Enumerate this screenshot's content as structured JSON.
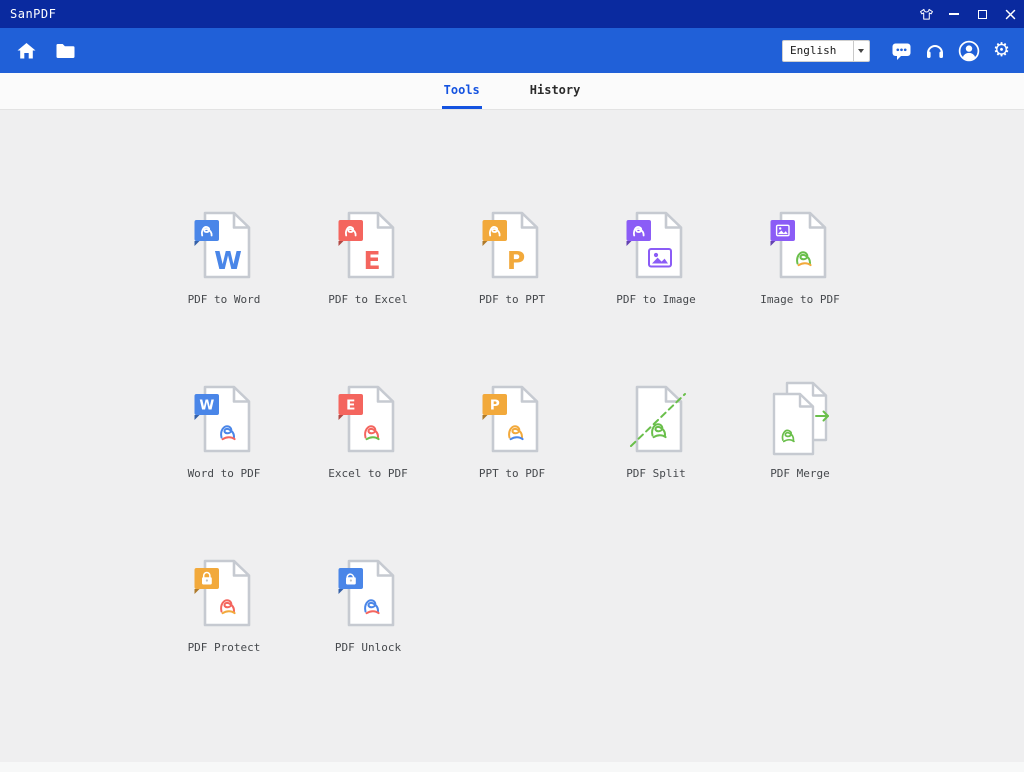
{
  "titlebar": {
    "title": "SanPDF",
    "icons": [
      "theme-icon",
      "minimize-button",
      "maximize-button",
      "close-button"
    ]
  },
  "toolbar": {
    "left_icons": [
      "home-icon",
      "folder-icon"
    ],
    "language": {
      "value": "English"
    },
    "right_icons": [
      "chat-icon",
      "headphones-icon",
      "user-icon",
      "settings-icon"
    ]
  },
  "tabs": [
    {
      "label": "Tools",
      "active": true
    },
    {
      "label": "History",
      "active": false
    }
  ],
  "colors": {
    "titlebar": "#0a2a9f",
    "toolbar": "#2060d8",
    "accent": "#1453e0",
    "background": "#efeff0",
    "blue": "#4a86e8",
    "red": "#f4655e",
    "orange": "#f2a93b",
    "purple": "#8b5cf6",
    "green": "#6abf4b"
  },
  "tools": [
    {
      "label": "PDF to Word",
      "variant": "single",
      "badge": {
        "color": "#4a86e8",
        "glyph": "pdf"
      },
      "body": {
        "glyph": "letter",
        "text": "W",
        "color": "#4a86e8"
      }
    },
    {
      "label": "PDF to Excel",
      "variant": "single",
      "badge": {
        "color": "#f4655e",
        "glyph": "pdf"
      },
      "body": {
        "glyph": "letter",
        "text": "E",
        "color": "#f4655e"
      }
    },
    {
      "label": "PDF to PPT",
      "variant": "single",
      "badge": {
        "color": "#f2a93b",
        "glyph": "pdf"
      },
      "body": {
        "glyph": "letter",
        "text": "P",
        "color": "#f2a93b"
      }
    },
    {
      "label": "PDF to Image",
      "variant": "single",
      "badge": {
        "color": "#8b5cf6",
        "glyph": "pdf"
      },
      "body": {
        "glyph": "image",
        "color": "#8b5cf6"
      }
    },
    {
      "label": "Image to PDF",
      "variant": "single",
      "badge": {
        "color": "#8b5cf6",
        "glyph": "image"
      },
      "body": {
        "glyph": "swirl",
        "colors": [
          "#6abf4b",
          "#f2a93b"
        ]
      }
    },
    {
      "label": "Word to PDF",
      "variant": "single",
      "badge": {
        "color": "#4a86e8",
        "glyph": "letter",
        "text": "W"
      },
      "body": {
        "glyph": "swirl",
        "colors": [
          "#4a86e8",
          "#f4655e"
        ]
      }
    },
    {
      "label": "Excel to PDF",
      "variant": "single",
      "badge": {
        "color": "#f4655e",
        "glyph": "letter",
        "text": "E"
      },
      "body": {
        "glyph": "swirl",
        "colors": [
          "#f4655e",
          "#6abf4b"
        ]
      }
    },
    {
      "label": "PPT to PDF",
      "variant": "single",
      "badge": {
        "color": "#f2a93b",
        "glyph": "letter",
        "text": "P"
      },
      "body": {
        "glyph": "swirl",
        "colors": [
          "#f2a93b",
          "#4a86e8"
        ]
      }
    },
    {
      "label": "PDF Split",
      "variant": "split",
      "accent": "#6abf4b",
      "body": {
        "glyph": "swirl",
        "colors": [
          "#6abf4b",
          "#6abf4b"
        ]
      }
    },
    {
      "label": "PDF Merge",
      "variant": "merge",
      "accent": "#6abf4b",
      "body": {
        "glyph": "swirl",
        "colors": [
          "#6abf4b",
          "#6abf4b"
        ]
      }
    },
    {
      "label": "PDF Protect",
      "variant": "single",
      "badge": {
        "color": "#f2a93b",
        "glyph": "lock"
      },
      "body": {
        "glyph": "swirl",
        "colors": [
          "#f4655e",
          "#f2a93b"
        ]
      }
    },
    {
      "label": "PDF Unlock",
      "variant": "single",
      "badge": {
        "color": "#4a86e8",
        "glyph": "unlock"
      },
      "body": {
        "glyph": "swirl",
        "colors": [
          "#4a86e8",
          "#f4655e"
        ]
      }
    }
  ]
}
